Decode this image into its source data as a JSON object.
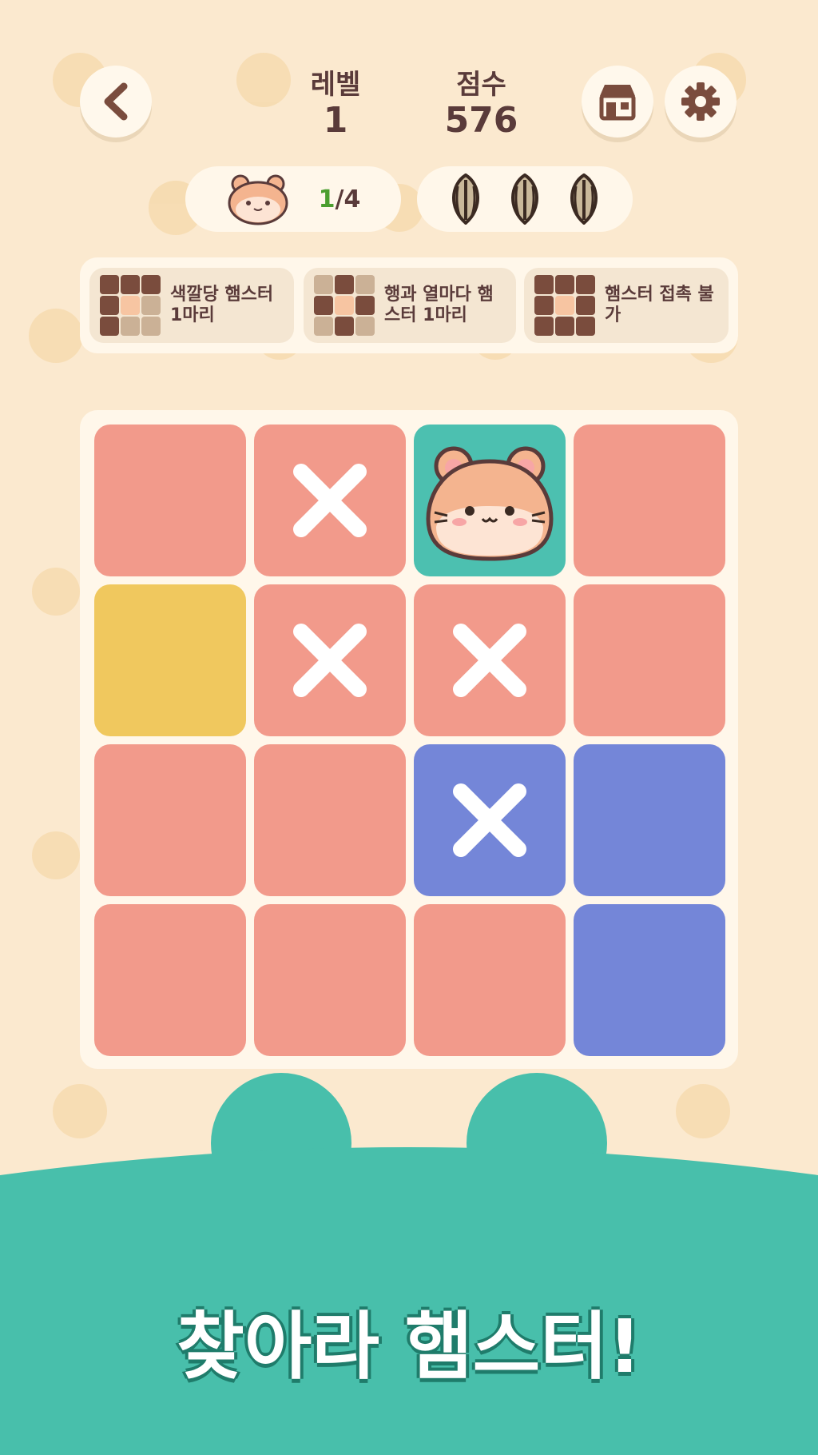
{
  "header": {
    "level_label": "레벨",
    "level_value": "1",
    "score_label": "점수",
    "score_value": "576"
  },
  "progress": {
    "found": "1",
    "total": "/4"
  },
  "seeds": {
    "count": 3
  },
  "rules": [
    {
      "label": "색깔당 햄스터\n1마리",
      "icon": "one-per-color-icon"
    },
    {
      "label": "행과 열마다 햄\n스터 1마리",
      "icon": "one-per-row-column-icon"
    },
    {
      "label": "햄스터 접촉 불\n가",
      "icon": "no-touching-icon"
    }
  ],
  "board": {
    "size": 4,
    "cells": [
      [
        "pink",
        "empty"
      ],
      [
        "pink",
        "x"
      ],
      [
        "teal",
        "hamster"
      ],
      [
        "pink",
        "empty"
      ],
      [
        "yellow",
        "empty"
      ],
      [
        "pink",
        "x"
      ],
      [
        "pink",
        "x"
      ],
      [
        "pink",
        "empty"
      ],
      [
        "pink",
        "empty"
      ],
      [
        "pink",
        "empty"
      ],
      [
        "blue",
        "x"
      ],
      [
        "blue",
        "empty"
      ],
      [
        "pink",
        "empty"
      ],
      [
        "pink",
        "empty"
      ],
      [
        "pink",
        "empty"
      ],
      [
        "blue",
        "empty"
      ]
    ]
  },
  "colors": {
    "pink": "#f29a8b",
    "yellow": "#f0c85e",
    "blue": "#7486d8",
    "teal": "#4cc0b0",
    "accent": "#48bfab"
  },
  "footer": {
    "title": "찾아라 햄스터!"
  }
}
